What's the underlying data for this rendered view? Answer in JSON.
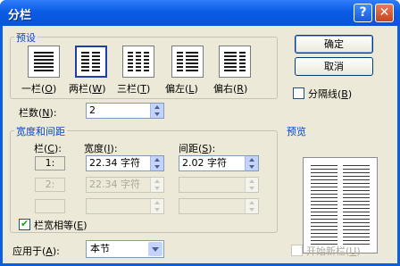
{
  "window": {
    "title": "分栏",
    "help_label": "?",
    "close_label": "✕"
  },
  "presets": {
    "group_label": "预设",
    "items": [
      {
        "label": "一栏",
        "key": "O"
      },
      {
        "label": "两栏",
        "key": "W"
      },
      {
        "label": "三栏",
        "key": "T"
      },
      {
        "label": "偏左",
        "key": "L"
      },
      {
        "label": "偏右",
        "key": "R"
      }
    ],
    "selected": "两栏"
  },
  "buttons": {
    "ok": "确定",
    "cancel": "取消"
  },
  "divider": {
    "label": "分隔线",
    "key": "B",
    "checked": false
  },
  "columns_count": {
    "label": "栏数",
    "key": "N",
    "value": "2"
  },
  "width_spacing": {
    "group_label": "宽度和间距",
    "col_header": "栏",
    "col_key": "C",
    "width_header": "宽度",
    "width_key": "I",
    "spacing_header": "间距",
    "spacing_key": "S",
    "rows": [
      {
        "num": "1:",
        "width": "22.34 字符",
        "spacing": "2.02 字符",
        "enabled": true
      },
      {
        "num": "2:",
        "width": "22.34 字符",
        "spacing": "",
        "enabled": false
      },
      {
        "num": "",
        "width": "",
        "spacing": "",
        "enabled": false
      }
    ]
  },
  "equal_width": {
    "label": "栏宽相等",
    "key": "E",
    "checked": true
  },
  "apply_to": {
    "label": "应用于",
    "key": "A",
    "value": "本节"
  },
  "preview": {
    "label": "预览"
  },
  "new_column": {
    "label": "开始新栏",
    "key": "U",
    "checked": false,
    "enabled": false
  }
}
